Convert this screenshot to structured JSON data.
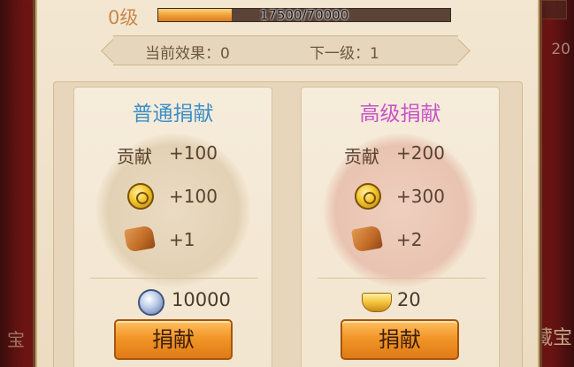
{
  "level": {
    "label": "0级",
    "progress_text": "17500/70000",
    "progress_current": 17500,
    "progress_max": 70000
  },
  "effect": {
    "current": "当前效果：0",
    "next": "下一级：1"
  },
  "normal": {
    "title": "普通捐献",
    "contrib_label": "贡献",
    "contrib_value": "+100",
    "coin_value": "+100",
    "scroll_value": "+1",
    "cost": "10000",
    "button": "捐献"
  },
  "advanced": {
    "title": "高级捐献",
    "contrib_label": "贡献",
    "contrib_value": "+200",
    "coin_value": "+300",
    "scroll_value": "+2",
    "cost": "20",
    "button": "捐献"
  },
  "side": {
    "left_label": "宝",
    "right_label": "藏宝",
    "right_number": "20"
  },
  "colors": {
    "normal_title": "#3d8fc6",
    "advanced_title": "#c853c8",
    "level_text": "#c9874a",
    "button": "#f29628"
  }
}
